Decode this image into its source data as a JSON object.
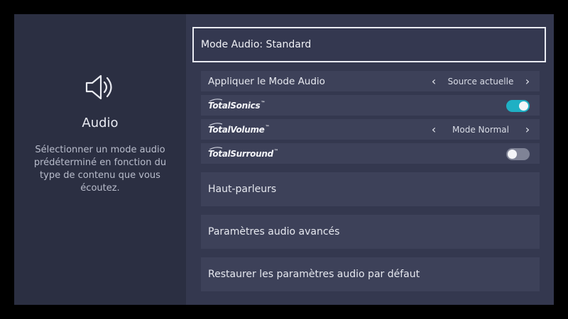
{
  "left_panel": {
    "icon": "speaker-icon",
    "title": "Audio",
    "description": "Sélectionner un mode audio prédéterminé en fonction du type de contenu que vous écoutez."
  },
  "header": {
    "title": "Mode Audio: Standard"
  },
  "settings": {
    "apply_mode": {
      "label": "Appliquer le Mode Audio",
      "value": "Source actuelle"
    },
    "total_sonics": {
      "label": "TotalSonics",
      "state": "on"
    },
    "total_volume": {
      "label": "TotalVolume",
      "value": "Mode Normal"
    },
    "total_surround": {
      "label": "TotalSurround",
      "state": "off"
    },
    "speakers": {
      "label": "Haut-parleurs"
    },
    "advanced": {
      "label": "Paramètres audio avancés"
    },
    "restore": {
      "label": "Restaurer les paramètres audio par défaut"
    }
  },
  "glyphs": {
    "chevron_left": "‹",
    "chevron_right": "›",
    "trademark": "™"
  },
  "colors": {
    "accent": "#1fb0c4",
    "panel": "#2b2f42",
    "row": "#3d4159"
  }
}
